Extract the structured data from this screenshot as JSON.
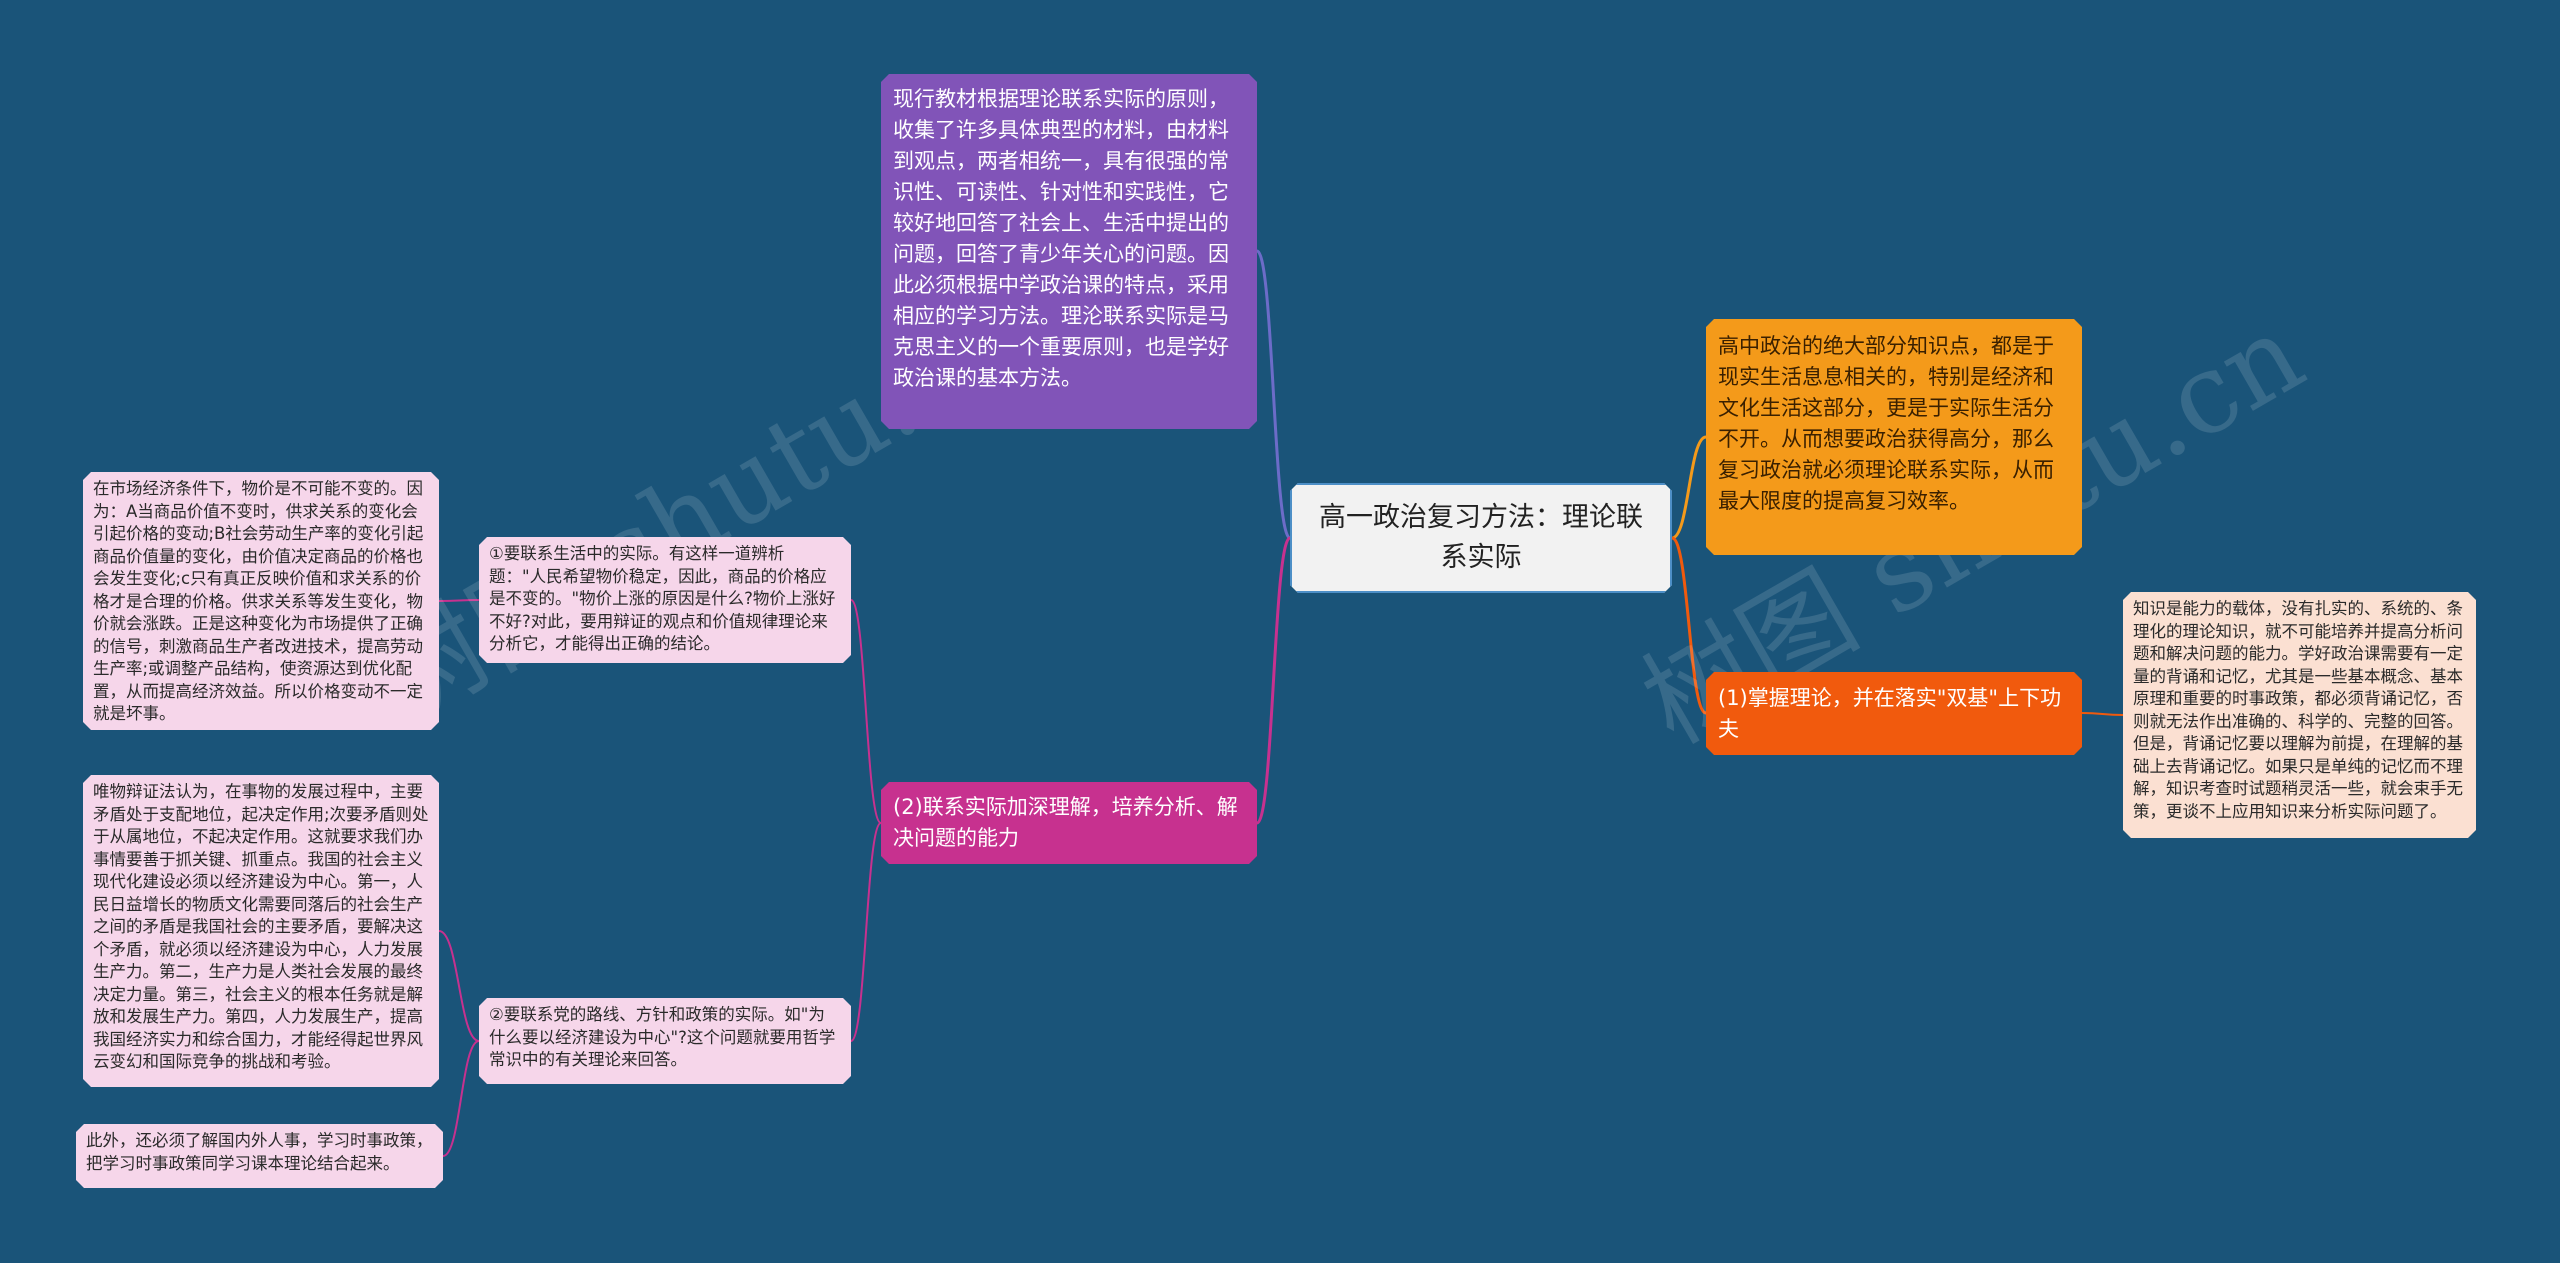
{
  "root": {
    "title": "高一政治复习方法：理论联系实际",
    "border_color": "#4d8fc7"
  },
  "colors": {
    "background": "#1a5479",
    "purple": "#8154b8",
    "magenta": "#c7318f",
    "orange": "#f49a1a",
    "deep_orange": "#f15a0d",
    "pink_leaf": "#f6d6ea",
    "peach_leaf": "#fbe0d2"
  },
  "left": {
    "top_node": {
      "text": "现行教材根据理论联系实际的原则，收集了许多具体典型的材料，由材料到观点，两者相统一，具有很强的常识性、可读性、针对性和实践性，它较好地回答了社会上、生活中提出的问题，回答了青少年关心的问题。因此必须根据中学政治课的特点，采用相应的学习方法。理沦联系实际是马克思主义的一个重要原则，也是学好政治课的基本方法。"
    },
    "branch": {
      "label": "(2)联系实际加深理解，培养分析、解决问题的能力",
      "child_1": {
        "text": "①要联系生活中的实际。有这样一道辨析题：\"人民希望物价稳定，因此，商品的价格应是不变的。\"物价上涨的原因是什么?物价上涨好不好?对此，要用辩证的观点和价值规律理论来分析它，才能得出正确的结论。",
        "detail": "在市场经济条件下，物价是不可能不变的。因为：A当商品价值不变时，供求关系的变化会引起价格的变动;B社会劳动生产率的变化引起商品价值量的变化，由价值决定商品的价格也会发生变化;c只有真正反映价值和求关系的价格才是合理的价格。供求关系等发生变化，物价就会涨跌。正是这种变化为市场提供了正确的信号，刺激商品生产者改进技术，提高劳动生产率;或调整产品结构，使资源达到优化配置，从而提高经济效益。所以价格变动不一定就是坏事。"
      },
      "child_2": {
        "text": "②要联系党的路线、方针和政策的实际。如\"为什么要以经济建设为中心\"?这个问题就要用哲学常识中的有关理论来回答。",
        "detail_1": "唯物辩证法认为，在事物的发展过程中，主要矛盾处于支配地位，起决定作用;次要矛盾则处于从属地位，不起决定作用。这就要求我们办事情要善于抓关键、抓重点。我国的社会主义现代化建设必须以经济建设为中心。第一，人民日益增长的物质文化需要同落后的社会生产之间的矛盾是我国社会的主要矛盾，要解决这个矛盾，就必须以经济建设为中心，人力发展生产力。第二，生产力是人类社会发展的最终决定力量。第三，社会主义的根本任务就是解放和发展生产力。第四，人力发展生产，提高我国经济实力和综合国力，才能经得起世界风云变幻和国际竞争的挑战和考验。",
        "detail_2": "此外，还必须了解国内外人事，学习时事政策，把学习时事政策同学习课本理论结合起来。"
      }
    }
  },
  "right": {
    "top_node": {
      "text": "高中政治的绝大部分知识点，都是于现实生活息息相关的，特别是经济和文化生活这部分，更是于实际生活分不开。从而想要政治获得高分，那么复习政治就必须理论联系实际，从而最大限度的提高复习效率。"
    },
    "branch": {
      "label": "(1)掌握理论，并在落实\"双基\"上下功夫",
      "detail": "知识是能力的载体，没有扎实的、系统的、条理化的理论知识，就不可能培养并提高分析问题和解决问题的能力。学好政治课需要有一定量的背诵和记忆，尤其是一些基本概念、基本原理和重要的时事政策，都必须背诵记忆，否则就无法作出准确的、科学的、完整的回答。但是，背诵记忆要以理解为前提，在理解的基础上去背诵记忆。如果只是单纯的记忆而不理解，知识考查时试题稍灵活一些，就会束手无策，更谈不上应用知识来分析实际问题了。"
    }
  },
  "watermarks": [
    "树图 shutu.cn",
    "树图 shutu.cn"
  ]
}
